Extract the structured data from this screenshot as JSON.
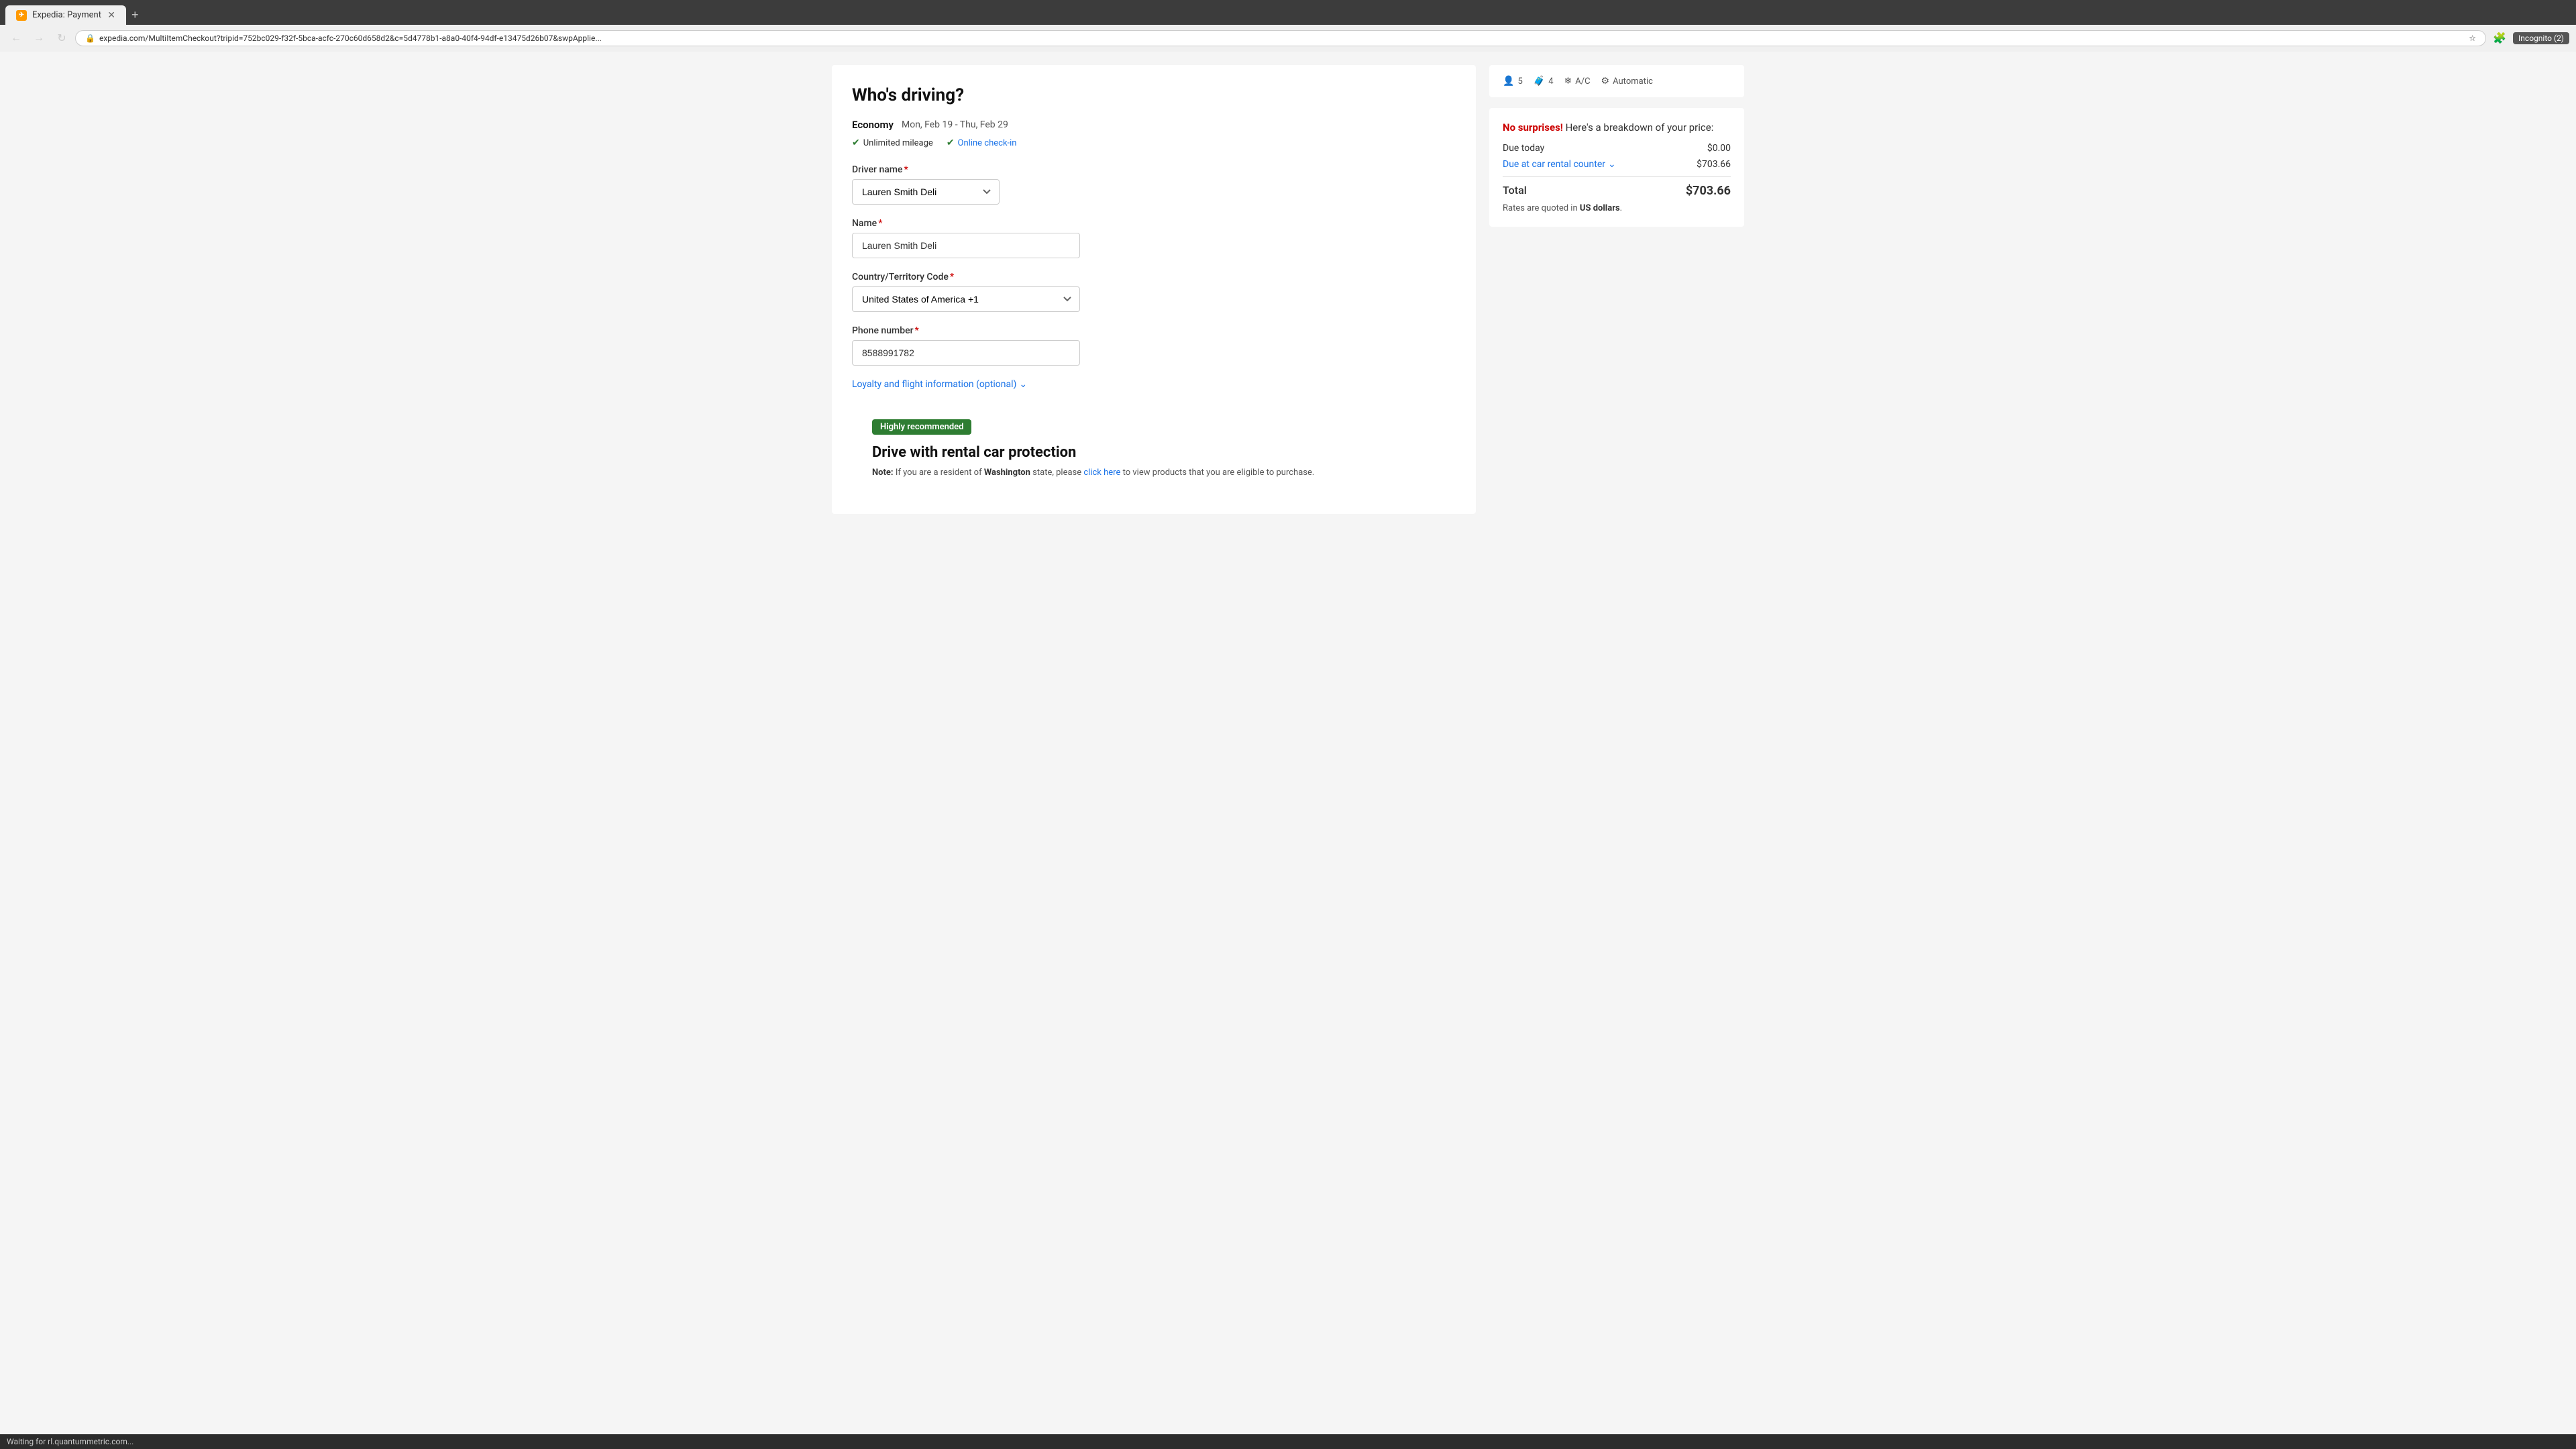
{
  "browser": {
    "tab_label": "Expedia: Payment",
    "tab_icon": "✈",
    "url": "expedia.com/MultiItemCheckout?tripid=752bc029-f32f-5bca-acfc-270c60d658d2&c=5d4778b1-a8a0-40f4-94df-e13475d26b07&swpApplie...",
    "incognito_label": "Incognito (2)"
  },
  "page_title": "Who's driving?",
  "car_section": {
    "car_type": "Economy",
    "date_range": "Mon, Feb 19 - Thu, Feb 29",
    "features": [
      {
        "label": "Unlimited mileage"
      },
      {
        "label": "Online check-in"
      }
    ]
  },
  "car_specs": [
    {
      "icon": "👤",
      "value": "5"
    },
    {
      "icon": "🧳",
      "value": "4"
    },
    {
      "icon": "❄",
      "value": "A/C"
    },
    {
      "icon": "⚙",
      "value": "Automatic"
    }
  ],
  "form": {
    "driver_name_label": "Driver name",
    "driver_name_value": "Lauren Smith Deli",
    "name_label": "Name",
    "name_value": "Lauren Smith Deli",
    "name_placeholder": "Lauren Smith Deli",
    "country_label": "Country/Territory Code",
    "country_value": "United States of America +1",
    "phone_label": "Phone number",
    "phone_value": "8588991782",
    "loyalty_label": "Loyalty and flight information (optional)"
  },
  "pricing": {
    "no_surprises_text": "No surprises!",
    "breakdown_text": "Here's a breakdown of your price:",
    "due_today_label": "Due today",
    "due_today_amount": "$0.00",
    "due_counter_label": "Due at car rental counter",
    "due_counter_amount": "$703.66",
    "total_label": "Total",
    "total_amount": "$703.66",
    "rates_note": "Rates are quoted in",
    "rates_currency": "US dollars",
    "rates_period": "."
  },
  "recommended_section": {
    "badge_label": "Highly recommended",
    "title": "Drive with rental car protection",
    "note_prefix": "Note:",
    "note_state": "Washington",
    "note_text": "If you are a resident of",
    "note_suffix": "state, please",
    "link_text": "click here",
    "note_end": "to view products that you are eligible to purchase."
  },
  "status_bar": {
    "text": "Waiting for rl.quantummetric.com..."
  }
}
